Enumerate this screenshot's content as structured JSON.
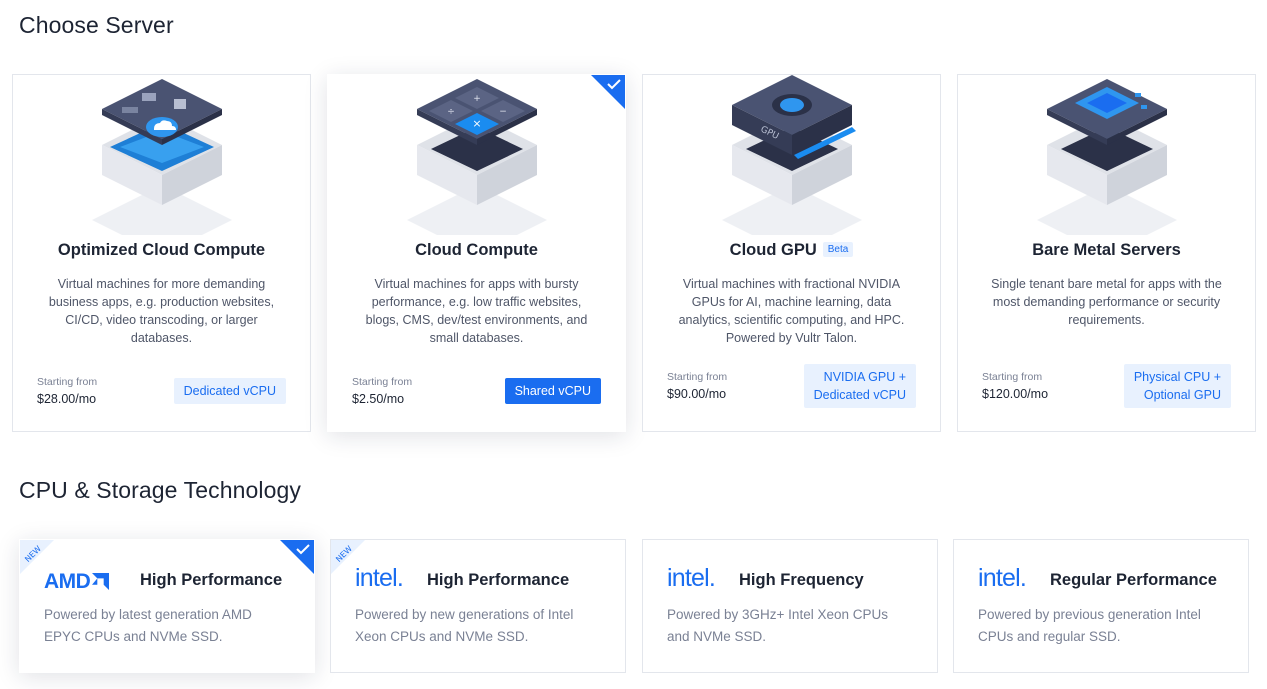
{
  "sections": {
    "server_title": "Choose Server",
    "cpu_title": "CPU & Storage Technology"
  },
  "servers": [
    {
      "title": "Optimized Cloud Compute",
      "description": "Virtual machines for more demanding business apps, e.g. production websites, CI/CD, video transcoding, or larger databases.",
      "price_label": "Starting from",
      "price": "$28.00/mo",
      "badge_line1": "Dedicated vCPU",
      "badge_line2": "",
      "selected": false,
      "icon": "optimized-server-icon"
    },
    {
      "title": "Cloud Compute",
      "description": "Virtual machines for apps with bursty performance, e.g. low traffic websites, blogs, CMS, dev/test environments, and small databases.",
      "price_label": "Starting from",
      "price": "$2.50/mo",
      "badge_line1": "Shared vCPU",
      "badge_line2": "",
      "selected": true,
      "icon": "cloud-compute-server-icon"
    },
    {
      "title": "Cloud GPU",
      "beta": "Beta",
      "description": "Virtual machines with fractional NVIDIA GPUs for AI, machine learning, data analytics, scientific computing, and HPC. Powered by Vultr Talon.",
      "price_label": "Starting from",
      "price": "$90.00/mo",
      "badge_line1": "NVIDIA GPU +",
      "badge_line2": "Dedicated vCPU",
      "selected": false,
      "icon": "gpu-server-icon",
      "gpu_label": "GPU"
    },
    {
      "title": "Bare Metal Servers",
      "description": "Single tenant bare metal for apps with the most demanding performance or security requirements.",
      "price_label": "Starting from",
      "price": "$120.00/mo",
      "badge_line1": "Physical CPU +",
      "badge_line2": "Optional GPU",
      "selected": false,
      "icon": "bare-metal-server-icon"
    }
  ],
  "cpus": [
    {
      "brand": "AMD",
      "title": "High Performance",
      "description": "Powered by latest generation AMD EPYC CPUs and NVMe SSD.",
      "ribbon": "NEW",
      "selected": true
    },
    {
      "brand": "intel.",
      "title": "High Performance",
      "description": "Powered by new generations of Intel Xeon CPUs and NVMe SSD.",
      "ribbon": "NEW",
      "selected": false
    },
    {
      "brand": "intel.",
      "title": "High Frequency",
      "description": "Powered by 3GHz+ Intel Xeon CPUs and NVMe SSD.",
      "ribbon": "",
      "selected": false
    },
    {
      "brand": "intel.",
      "title": "Regular Performance",
      "description": "Powered by previous generation Intel CPUs and regular SSD.",
      "ribbon": "",
      "selected": false
    }
  ],
  "colors": {
    "accent": "#1a6df0",
    "badge_bg": "#e8f1fe",
    "amd": "#1a6df0",
    "intel": "#1a6df0"
  }
}
